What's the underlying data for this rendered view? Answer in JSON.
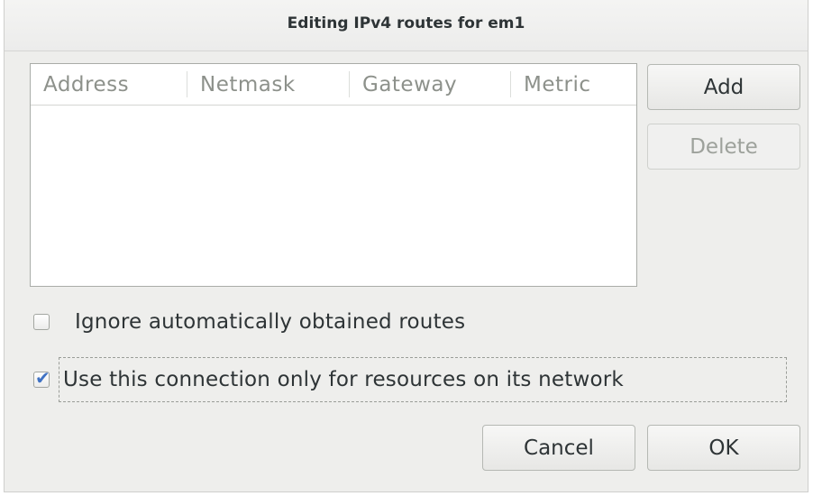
{
  "dialog": {
    "title": "Editing IPv4 routes for em1"
  },
  "routes_table": {
    "columns": [
      "Address",
      "Netmask",
      "Gateway",
      "Metric"
    ],
    "rows": []
  },
  "buttons": {
    "add_label": "Add",
    "delete_label": "Delete",
    "cancel_label": "Cancel",
    "ok_label": "OK"
  },
  "options": {
    "ignore_routes": {
      "label": "Ignore automatically obtained routes",
      "checked": false
    },
    "use_connection_only": {
      "label": "Use this connection only for resources on its network",
      "checked": true
    }
  },
  "icons": {
    "check_mark": "check-icon"
  },
  "colors": {
    "check_accent": "#3f72c4",
    "disabled_text": "#9da19b",
    "dialog_bg": "#eeeeec"
  }
}
